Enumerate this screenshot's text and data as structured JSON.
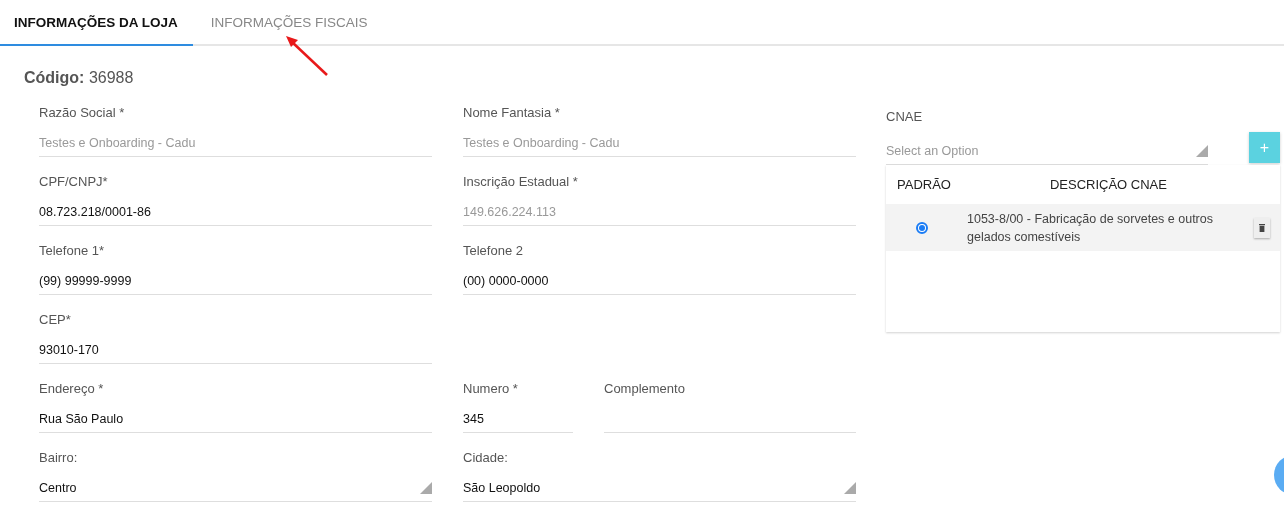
{
  "tabs": [
    {
      "label": "INFORMAÇÕES DA LOJA",
      "selected": true
    },
    {
      "label": "INFORMAÇÕES FISCAIS",
      "selected": false
    }
  ],
  "code": {
    "label": "Código:",
    "value": "36988"
  },
  "form": {
    "rows": [
      {
        "left": [
          {
            "kind": "text",
            "label": "Razão Social *",
            "value": "Testes e Onboarding - Cadu",
            "disabled": true
          }
        ],
        "right": [
          {
            "kind": "text",
            "label": "Nome Fantasia *",
            "value": "Testes e Onboarding - Cadu",
            "disabled": true
          }
        ]
      },
      {
        "left": [
          {
            "kind": "text",
            "label": "CPF/CNPJ*",
            "value": "08.723.218/0001-86",
            "disabled": false
          }
        ],
        "right": [
          {
            "kind": "text",
            "label": "Inscrição Estadual *",
            "value": "149.626.224.113",
            "disabled": true
          }
        ]
      },
      {
        "left": [
          {
            "kind": "text",
            "label": "Telefone 1*",
            "value": "(99) 99999-9999",
            "disabled": false
          }
        ],
        "right": [
          {
            "kind": "text",
            "label": "Telefone 2",
            "value": "(00) 0000-0000",
            "disabled": false
          }
        ]
      },
      {
        "left": [
          {
            "kind": "text",
            "label": "CEP*",
            "value": "93010-170",
            "disabled": false
          }
        ],
        "right": []
      },
      {
        "left": [
          {
            "kind": "text",
            "label": "Endereço *",
            "value": "Rua São Paulo",
            "disabled": false
          }
        ],
        "right": [
          {
            "kind": "text",
            "label": "Numero *",
            "value": "345",
            "disabled": false
          },
          {
            "kind": "text",
            "label": "Complemento"
          }
        ]
      },
      {
        "left": [
          {
            "kind": "select",
            "label": "Bairro:",
            "value": "Centro",
            "disabled": false
          }
        ],
        "right": [
          {
            "kind": "select",
            "label": "Cidade:",
            "value": "São Leopoldo",
            "disabled": false
          }
        ]
      }
    ]
  },
  "cnae": {
    "label": "CNAE",
    "select": {
      "placeholder": "Select an Option"
    },
    "add_button": "+",
    "table": {
      "columns": [
        "PADRÃO",
        "DESCRIÇÃO CNAE"
      ],
      "rows": [
        {
          "selected": true,
          "description": "1053-8/00 - Fabricação de sorvetes e outros gelados comestíveis"
        }
      ]
    }
  }
}
